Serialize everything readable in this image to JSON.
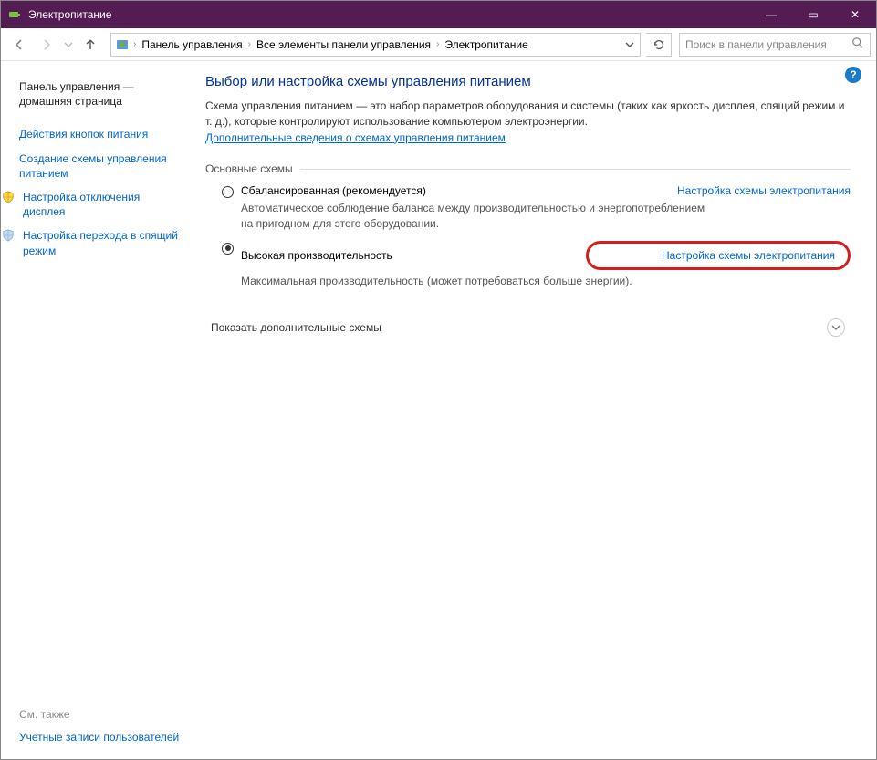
{
  "window": {
    "title": "Электропитание",
    "min_icon": "—",
    "max_icon": "▭",
    "close_icon": "✕"
  },
  "breadcrumb": {
    "items": [
      "Панель управления",
      "Все элементы панели управления",
      "Электропитание"
    ]
  },
  "search": {
    "placeholder": "Поиск в панели управления"
  },
  "sidebar": {
    "home_line1": "Панель управления —",
    "home_line2": "домашняя страница",
    "links": [
      "Действия кнопок питания",
      "Создание схемы управления питанием",
      "Настройка отключения дисплея",
      "Настройка перехода в спящий режим"
    ],
    "see_also_label": "См. также",
    "see_also_link": "Учетные записи пользователей"
  },
  "main": {
    "title": "Выбор или настройка схемы управления питанием",
    "desc": "Схема управления питанием — это набор параметров оборудования и системы (таких как яркость дисплея, спящий режим и т. д.), которые контролируют использование компьютером электроэнергии.",
    "more_link": "Дополнительные сведения о схемах управления питанием",
    "section_basic": "Основные схемы",
    "plans": [
      {
        "name": "Сбалансированная (рекомендуется)",
        "link": "Настройка схемы электропитания",
        "desc": "Автоматическое соблюдение баланса между производительностью и энергопотреблением на пригодном для этого оборудовании.",
        "checked": false
      },
      {
        "name": "Высокая производительность",
        "link": "Настройка схемы электропитания",
        "desc": "Максимальная производительность (может потребоваться больше энергии).",
        "checked": true
      }
    ],
    "show_more": "Показать дополнительные схемы"
  }
}
